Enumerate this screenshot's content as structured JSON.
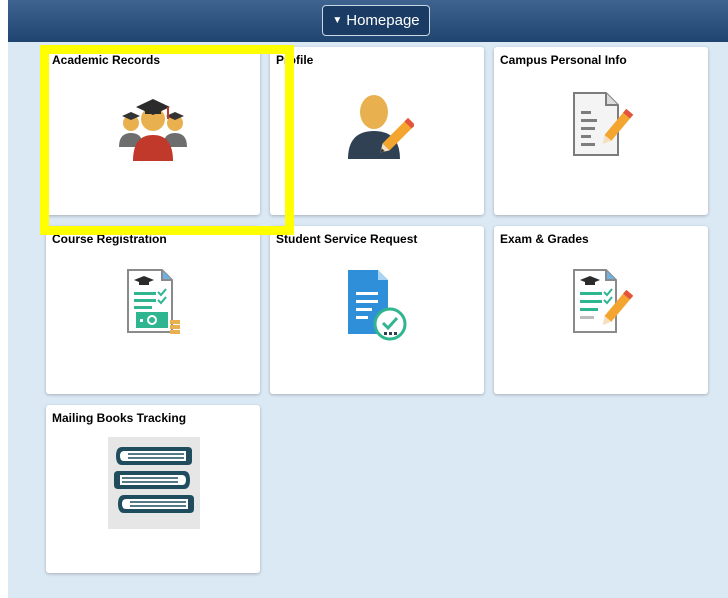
{
  "header": {
    "homepage_label": "Homepage"
  },
  "tiles": [
    {
      "title": "Academic Records",
      "icon": "graduates-icon"
    },
    {
      "title": "Profile",
      "icon": "user-edit-icon"
    },
    {
      "title": "Campus Personal Info",
      "icon": "document-edit-icon"
    },
    {
      "title": "Course Registration",
      "icon": "registration-payment-icon"
    },
    {
      "title": "Student Service Request",
      "icon": "document-check-icon"
    },
    {
      "title": "Exam & Grades",
      "icon": "exam-edit-icon"
    },
    {
      "title": "Mailing Books Tracking",
      "icon": "books-stack-icon"
    }
  ],
  "colors": {
    "header": "#1f4470",
    "background": "#dbe9f5",
    "highlight": "#ffff00"
  }
}
